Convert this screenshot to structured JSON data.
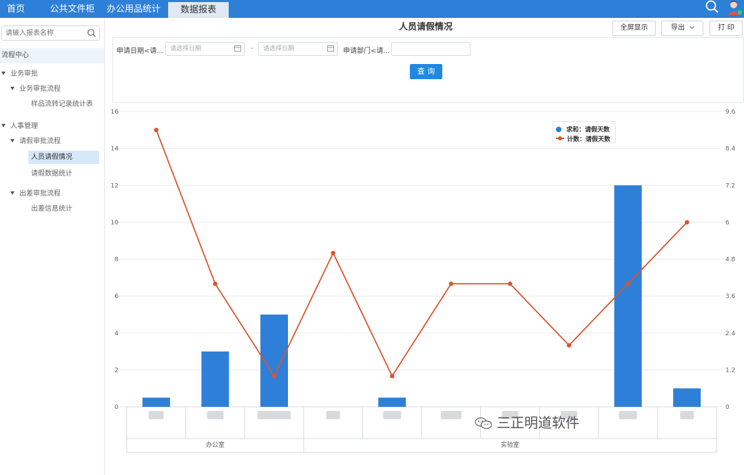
{
  "topbar": {
    "tabs": [
      {
        "label": "首页",
        "active": false
      },
      {
        "label": "公共文件柜",
        "active": false
      },
      {
        "label": "办公用品统计",
        "active": false
      },
      {
        "label": "数据报表",
        "active": true
      }
    ]
  },
  "sidebar": {
    "search_placeholder": "请输入报表名称",
    "flow_center": "流程中心",
    "tree": [
      {
        "label": "业务审批",
        "level": 0,
        "expanded": true,
        "selected": false
      },
      {
        "label": "业务审批流程",
        "level": 1,
        "expanded": true,
        "selected": false
      },
      {
        "label": "样品流转记录统计表",
        "level": 2,
        "selected": false
      },
      {
        "label": "人事管理",
        "level": 0,
        "expanded": true,
        "selected": false
      },
      {
        "label": "请假审批流程",
        "level": 1,
        "expanded": true,
        "selected": false
      },
      {
        "label": "人员请假情况",
        "level": 2,
        "selected": true
      },
      {
        "label": "请假数据统计",
        "level": 2,
        "selected": false
      },
      {
        "label": "出差审批流程",
        "level": 1,
        "expanded": true,
        "selected": false
      },
      {
        "label": "出差信息统计",
        "level": 2,
        "selected": false
      }
    ]
  },
  "main": {
    "title": "人员请假情况",
    "toolbar": {
      "fullscreen_label": "全屏显示",
      "export_label": "导出",
      "print_label": "打 印"
    },
    "filter": {
      "date_label": "申请日期<请...",
      "date_start_placeholder": "请选择日期",
      "date_separator": "-",
      "date_end_placeholder": "请选择日期",
      "dept_label": "申请部门<请...",
      "dept_value": "",
      "query_label": "查 询"
    }
  },
  "chart_data": {
    "type": "bar",
    "title": "",
    "xlabel": "",
    "ylabel": "",
    "category_groups": [
      {
        "name": "办公室",
        "span": 3
      },
      {
        "name": "实验室",
        "span": 7
      }
    ],
    "categories": [
      "",
      "",
      "",
      "",
      "",
      "",
      "",
      "",
      "",
      ""
    ],
    "ylim": [
      0,
      16
    ],
    "yticks": [
      "0",
      "2",
      "4",
      "6",
      "8",
      "10",
      "12",
      "14",
      "16"
    ],
    "y2lim": [
      0,
      9.6
    ],
    "y2ticks": [
      "0",
      "1.2",
      "2.4",
      "3.6",
      "4.8",
      "6",
      "7.2",
      "8.4",
      "9.6"
    ],
    "grid": true,
    "legend_position": "top-right",
    "series": [
      {
        "name": "求和：请假天数",
        "type": "bar",
        "axis": "left",
        "color": "#2e7fd8",
        "values": [
          0.5,
          3,
          5,
          0,
          0.5,
          0,
          0,
          0,
          12,
          1
        ]
      },
      {
        "name": "计数：请假天数",
        "type": "line",
        "axis": "right",
        "color": "#d9552e",
        "values": [
          9,
          4,
          1,
          5,
          1,
          4,
          4,
          2,
          4,
          6
        ]
      }
    ]
  },
  "watermark": {
    "text": "三正明道软件"
  }
}
